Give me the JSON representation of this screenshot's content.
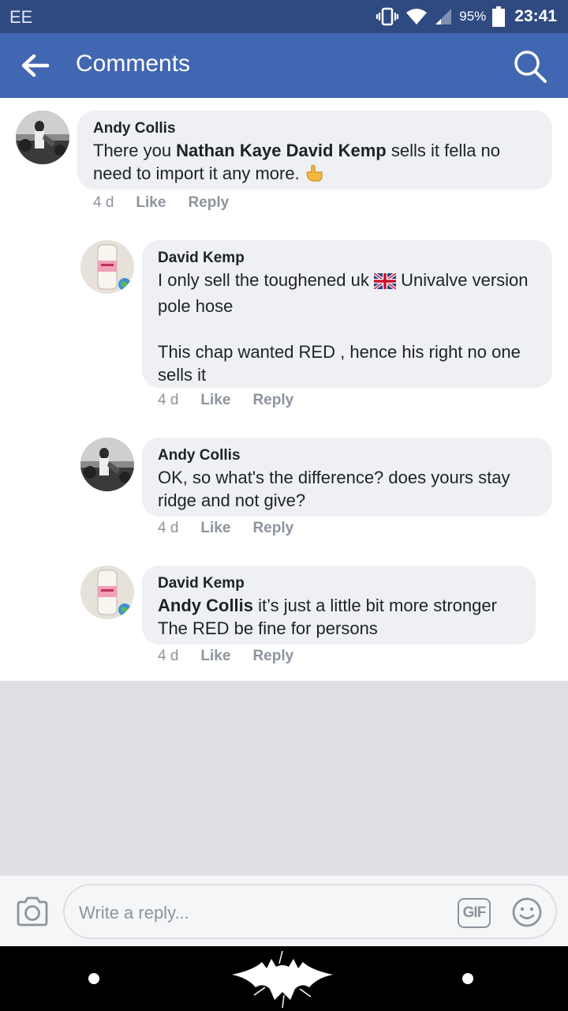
{
  "status_bar": {
    "carrier": "EE",
    "battery": "95%",
    "time": "23:41"
  },
  "header": {
    "title": "Comments",
    "back_icon": "arrow-left-icon",
    "search_icon": "search-icon"
  },
  "comments": [
    {
      "author": "Andy Collis",
      "text_parts": [
        "There you ",
        "Nathan Kaye",
        " ",
        "David Kemp",
        " sells it fella no need to import it any more."
      ],
      "emoji": "thumb-pointing-icon",
      "time": "4 d",
      "like": "Like",
      "reply": "Reply"
    },
    {
      "author": "David Kemp",
      "line1_a": "I only sell the toughened uk",
      "line1_b": "Univalve version pole hose",
      "line2": "This chap wanted RED , hence his right no one sells it",
      "time": "4 d",
      "like": "Like",
      "reply": "Reply"
    },
    {
      "author": "Andy Collis",
      "text": "OK, so what's the difference? does yours stay ridge and not give?",
      "time": "4 d",
      "like": "Like",
      "reply": "Reply"
    },
    {
      "author": "David Kemp",
      "mention": "Andy Collis",
      "text_a": " it’s just a little bit more stronger",
      "text_b": "The RED be fine for persons",
      "time": "4 d",
      "like": "Like",
      "reply": "Reply"
    }
  ],
  "composer": {
    "placeholder": "Write a reply...",
    "gif_label": "GIF"
  },
  "colors": {
    "status_bar": "#2f4a80",
    "header": "#4267b2",
    "bubble": "#eff0f3",
    "meta": "#8d949e"
  }
}
